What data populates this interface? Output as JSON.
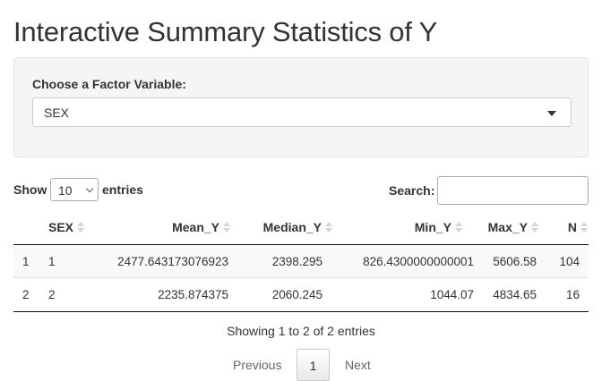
{
  "page": {
    "title": "Interactive Summary Statistics of Y"
  },
  "factor_select": {
    "label": "Choose a Factor Variable:",
    "value": "SEX"
  },
  "length_menu": {
    "prefix": "Show",
    "value": "10",
    "suffix": "entries"
  },
  "search": {
    "label": "Search:",
    "value": ""
  },
  "table": {
    "columns": [
      "",
      "SEX",
      "Mean_Y",
      "Median_Y",
      "Min_Y",
      "Max_Y",
      "N"
    ],
    "rows": [
      [
        "1",
        "1",
        "2477.643173076923",
        "2398.295",
        "826.4300000000001",
        "5606.58",
        "104"
      ],
      [
        "2",
        "2",
        "2235.874375",
        "2060.245",
        "1044.07",
        "4834.65",
        "16"
      ]
    ]
  },
  "info": "Showing 1 to 2 of 2 entries",
  "pagination": {
    "previous": "Previous",
    "current": "1",
    "next": "Next"
  }
}
